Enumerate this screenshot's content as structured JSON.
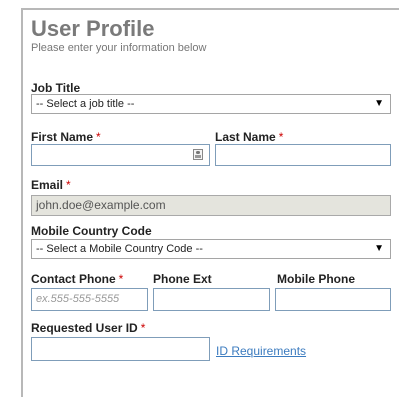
{
  "header": {
    "title": "User Profile",
    "subtitle": "Please enter your information below"
  },
  "form": {
    "job_title": {
      "label": "Job Title",
      "selected": "-- Select a job title --"
    },
    "first_name": {
      "label": "First Name",
      "required_mark": "*",
      "value": ""
    },
    "last_name": {
      "label": "Last Name",
      "required_mark": "*",
      "value": ""
    },
    "email": {
      "label": "Email",
      "required_mark": "*",
      "value": "john.doe@example.com"
    },
    "mobile_country_code": {
      "label": "Mobile Country Code",
      "selected": "-- Select a Mobile Country Code --"
    },
    "contact_phone": {
      "label": "Contact Phone",
      "required_mark": "*",
      "placeholder": "ex.555-555-5555"
    },
    "phone_ext": {
      "label": "Phone Ext",
      "value": ""
    },
    "mobile_phone": {
      "label": "Mobile Phone",
      "value": ""
    },
    "requested_user_id": {
      "label": "Requested User ID",
      "required_mark": "*",
      "value": ""
    },
    "id_requirements_link": "ID Requirements"
  },
  "icons": {
    "dropdown": "dropdown-arrow-icon",
    "contact_card": "contact-card-icon"
  },
  "colors": {
    "title": "#7a7a7a",
    "required": "#cc0000",
    "link": "#3b7bbf",
    "readonly_bg": "#e4e4dd"
  }
}
